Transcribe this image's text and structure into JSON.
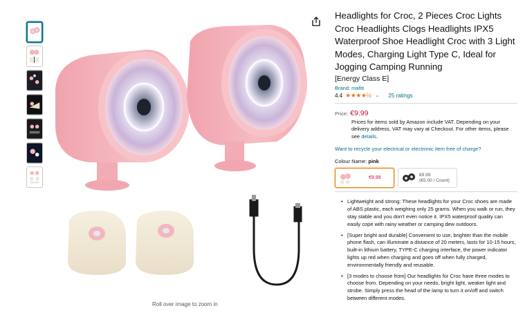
{
  "product": {
    "title": "Headlights for Croc, 2 Pieces Croc Lights Croc Headlights Clogs Headlights IPX5 Waterproof Shoe Headlight Croc with 3 Light Modes, Charging Light Type C, Ideal for Jogging Camping Running",
    "energy_class": "[Energy Class E]",
    "brand": "Brand: mafiti",
    "rating_value": "4.4",
    "stars_glyphs": "★★★★½",
    "ratings_count": "25 ratings"
  },
  "pricing": {
    "label": "Price:",
    "price": "€9.99",
    "vat_note_prefix": "Prices for items sold by Amazon include VAT. Depending on your delivery address, VAT may vary at Checkout. For other items, please see ",
    "vat_link": "details",
    "vat_note_suffix": "."
  },
  "recycle_link": "Want to recycle your electrical or electronic item free of charge?",
  "colour": {
    "label": "Colour Name:",
    "value": "pink",
    "options": [
      {
        "price": "€9.99",
        "selected": true
      },
      {
        "price": "€9.99",
        "unit_price": "(€5.00 / Count)",
        "selected": false
      }
    ]
  },
  "bullets": [
    "Lightweight and strong: These headlights for your Croc shoes are made of ABS plastic, each weighing only 25 grams. When you walk or run, they stay stable and you don't even notice it. IPX5 waterproof quality can easily cope with rainy weather or camping dew outdoors.",
    "[Super bright and durable] Convenient to use, brighter than the mobile phone flash, can illuminate a distance of 20 meters, lasts for 10-15 hours, built-in lithium battery, TYPE-C charging interface, the power indicator lights up red when charging and goes off when fully charged, environmentally friendly and reusable.",
    "[3 modes to choose from] Our headlights for Croc have three modes to choose from. Depending on your needs, bright light, weaker light and strobe. Simply press the head of the lamp to turn it on/off and switch between different modes."
  ],
  "image": {
    "zoom_hint": "Roll over image to zoom in",
    "thumbnail_count": 7
  },
  "colors": {
    "price_red": "#cc0c39",
    "link_teal": "#007185",
    "star_orange": "#de7921",
    "selected_border": "#e77600",
    "product_pink": "#f4b6bd"
  }
}
